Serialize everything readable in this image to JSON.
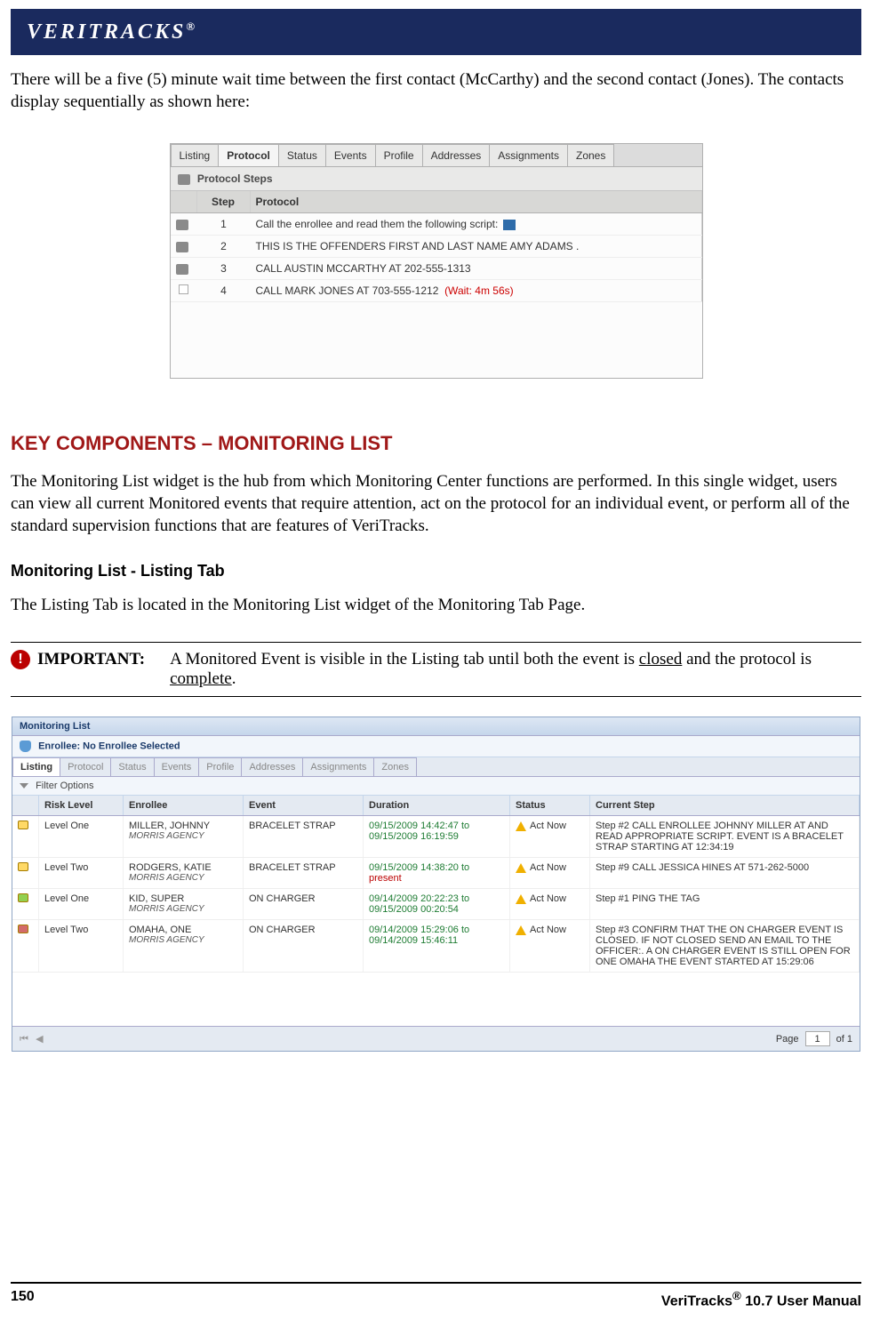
{
  "banner": {
    "brand": "VERITRACKS",
    "reg": "®"
  },
  "intro": "There will be a five (5) minute wait time between the first contact (McCarthy) and the second contact (Jones).  The contacts display sequentially as shown here:",
  "proto": {
    "tabs": [
      "Listing",
      "Protocol",
      "Status",
      "Events",
      "Profile",
      "Addresses",
      "Assignments",
      "Zones"
    ],
    "active_tab": "Protocol",
    "subheader": "Protocol Steps",
    "cols": [
      "Step",
      "Protocol"
    ],
    "rows": [
      {
        "step": "1",
        "text": "Call the enrollee and read them the following script:",
        "blue": true,
        "checked": true
      },
      {
        "step": "2",
        "text": "THIS IS THE OFFENDERS FIRST AND LAST NAME AMY ADAMS .",
        "blue": false,
        "checked": true
      },
      {
        "step": "3",
        "text": "CALL AUSTIN MCCARTHY AT 202-555-1313",
        "blue": false,
        "checked": true
      },
      {
        "step": "4",
        "text": "CALL MARK JONES AT 703-555-1212",
        "wait": "(Wait: 4m 56s)",
        "blue": false,
        "checked": false
      }
    ]
  },
  "heading": "KEY COMPONENTS – MONITORING LIST",
  "heading_text": "The Monitoring List widget is the hub from which Monitoring Center functions are performed.  In this single widget, users can view all current Monitored events that require attention, act on the protocol for an individual event, or perform all of the standard supervision functions that are features of VeriTracks.",
  "subheading": "Monitoring List - Listing Tab",
  "subheading_text": "The Listing Tab is located in the Monitoring List widget of the Monitoring Tab Page.",
  "important": {
    "label": "IMPORTANT:",
    "pre": "A Monitored Event is visible in the Listing tab until both the event is ",
    "u1": "closed",
    "mid": " and the protocol is ",
    "u2": "complete",
    "post": "."
  },
  "ml": {
    "title": "Monitoring List",
    "enrollee": "Enrollee:  No Enrollee Selected",
    "tabs": [
      "Listing",
      "Protocol",
      "Status",
      "Events",
      "Profile",
      "Addresses",
      "Assignments",
      "Zones"
    ],
    "active_tab": "Listing",
    "filter": "Filter Options",
    "cols": [
      "Risk Level",
      "Enrollee",
      "Event",
      "Duration",
      "Status",
      "Current Step"
    ],
    "rows": [
      {
        "lock": "closed-y",
        "risk": "Level One",
        "name": "MILLER, JOHNNY",
        "agency": "MORRIS AGENCY",
        "event": "BRACELET STRAP",
        "dur1": "09/15/2009 14:42:47 to",
        "dur2": "09/15/2009 16:19:59",
        "dur2_red": false,
        "status": "Act Now",
        "step": "Step #2 CALL ENROLLEE JOHNNY MILLER AT AND READ APPROPRIATE SCRIPT. EVENT IS A BRACELET STRAP STARTING AT 12:34:19"
      },
      {
        "lock": "closed-y",
        "risk": "Level Two",
        "name": "RODGERS, KATIE",
        "agency": "MORRIS AGENCY",
        "event": "BRACELET STRAP",
        "dur1": "09/15/2009 14:38:20 to",
        "dur2": "present",
        "dur2_red": true,
        "status": "Act Now",
        "step": "Step #9 CALL JESSICA HINES AT 571-262-5000"
      },
      {
        "lock": "open-g",
        "risk": "Level One",
        "name": "KID, SUPER",
        "agency": "MORRIS AGENCY",
        "event": "ON CHARGER",
        "dur1": "09/14/2009 20:22:23 to",
        "dur2": "09/15/2009 00:20:54",
        "dur2_red": false,
        "status": "Act Now",
        "step": "Step #1 PING THE TAG"
      },
      {
        "lock": "closed-r",
        "risk": "Level Two",
        "name": "OMAHA, ONE",
        "agency": "MORRIS AGENCY",
        "event": "ON CHARGER",
        "dur1": "09/14/2009 15:29:06 to",
        "dur2": "09/14/2009 15:46:11",
        "dur2_red": false,
        "status": "Act Now",
        "step": "Step #3 CONFIRM THAT THE ON CHARGER EVENT IS CLOSED. IF NOT CLOSED SEND AN EMAIL TO THE OFFICER:. A ON CHARGER EVENT IS STILL OPEN FOR ONE OMAHA THE EVENT STARTED AT 15:29:06"
      }
    ],
    "footer": {
      "page_label": "Page",
      "page_num": "1",
      "of": "of 1"
    }
  },
  "footer": {
    "page": "150",
    "right_a": "VeriTracks",
    "right_b": "®",
    "right_c": " 10.7 User Manual"
  }
}
